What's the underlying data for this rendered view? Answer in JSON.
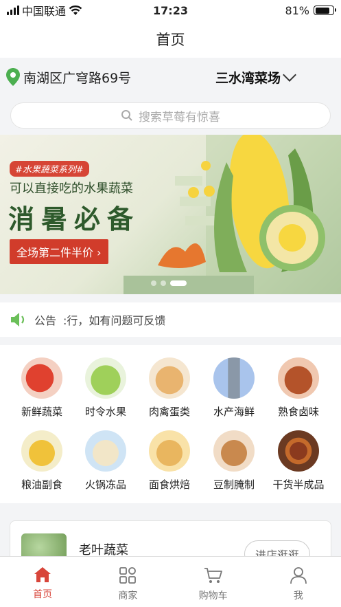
{
  "status_bar": {
    "carrier": "中国联通",
    "time": "17:23",
    "battery": "81%",
    "battery_level": 0.81
  },
  "nav": {
    "title": "首页"
  },
  "location": {
    "address": "南湖区广穹路69号",
    "market": "三水湾菜场"
  },
  "search": {
    "placeholder": "搜索草莓有惊喜"
  },
  "banner": {
    "tag": "#水果蔬菜系列#",
    "subtitle": "可以直接吃的水果蔬菜",
    "headline": "消暑必备",
    "button": "全场第二件半价 ›",
    "slides": 3,
    "active_slide": 3
  },
  "notice": {
    "label": "公告",
    "text": ":行，如有问题可反馈"
  },
  "categories": [
    {
      "label": "新鲜蔬菜",
      "icon": "tomato-icon"
    },
    {
      "label": "时令水果",
      "icon": "apple-icon"
    },
    {
      "label": "肉禽蛋类",
      "icon": "egg-icon"
    },
    {
      "label": "水产海鲜",
      "icon": "fish-icon"
    },
    {
      "label": "熟食卤味",
      "icon": "roast-chicken-icon"
    },
    {
      "label": "粮油副食",
      "icon": "oil-icon"
    },
    {
      "label": "火锅冻品",
      "icon": "dumpling-icon"
    },
    {
      "label": "面食烘焙",
      "icon": "bread-icon"
    },
    {
      "label": "豆制腌制",
      "icon": "tofu-icon"
    },
    {
      "label": "干货半成品",
      "icon": "spice-icon"
    }
  ],
  "shop": {
    "name": "老叶蔬菜",
    "button": "进店逛逛"
  },
  "tabs": [
    {
      "label": "首页",
      "icon": "home-icon",
      "active": true
    },
    {
      "label": "商家",
      "icon": "shops-icon",
      "active": false
    },
    {
      "label": "购物车",
      "icon": "cart-icon",
      "active": false
    },
    {
      "label": "我",
      "icon": "user-icon",
      "active": false
    }
  ],
  "colors": {
    "accent": "#d8453a",
    "location_pin": "#4caf50",
    "banner_red": "#d13c2b",
    "banner_green": "#2e5a2c"
  }
}
